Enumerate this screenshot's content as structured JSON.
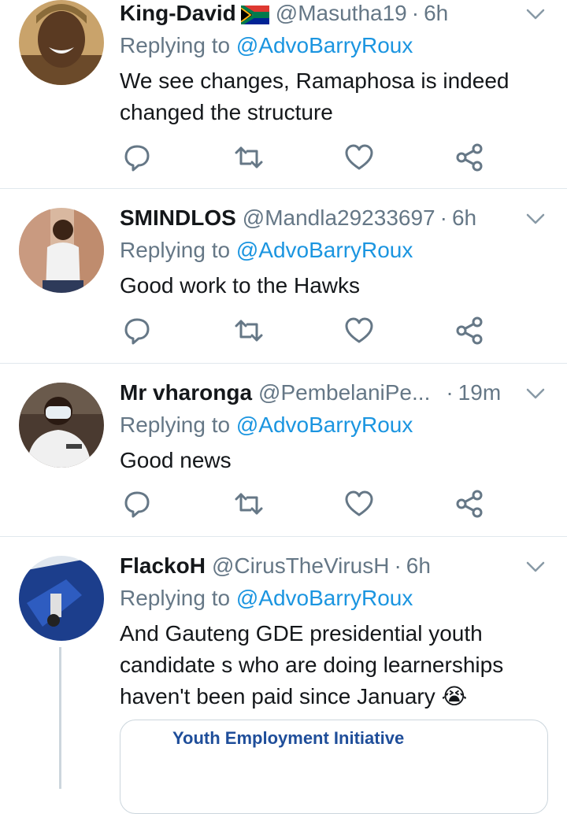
{
  "tweets": [
    {
      "name": "King-David",
      "handle": "@Masutha19",
      "dot": "·",
      "time": "6h",
      "replying_prefix": "Replying to ",
      "replying_to": "@AdvoBarryRoux",
      "text": "We see changes, Ramaphosa is indeed changed the structure"
    },
    {
      "name": "SMINDLOS",
      "handle": "@Mandla29233697",
      "dot": "·",
      "time": "6h",
      "replying_prefix": "Replying to ",
      "replying_to": "@AdvoBarryRoux",
      "text": "Good work to the Hawks"
    },
    {
      "name": "Mr vharonga",
      "handle": "@PembelaniPe...",
      "dot": "·",
      "time": "19m",
      "replying_prefix": "Replying to ",
      "replying_to": "@AdvoBarryRoux",
      "text": "Good news"
    },
    {
      "name": "FlackoH",
      "handle": "@CirusTheVirusH",
      "dot": "·",
      "time": "6h",
      "replying_prefix": "Replying to ",
      "replying_to": "@AdvoBarryRoux",
      "text": "And Gauteng GDE presidential youth candidate s who are doing learnerships haven't been paid since January",
      "emoji": "😭"
    }
  ],
  "card": {
    "title": "Youth Employment Initiative"
  },
  "icons": {
    "reply": "reply-icon",
    "retweet": "retweet-icon",
    "like": "heart-icon",
    "share": "share-icon",
    "more": "chevron-down-icon",
    "flag": "south-africa-flag-icon"
  },
  "colors": {
    "text": "#14171a",
    "secondary": "#657786",
    "link": "#1b95e0",
    "divider": "#e1e8ed"
  }
}
